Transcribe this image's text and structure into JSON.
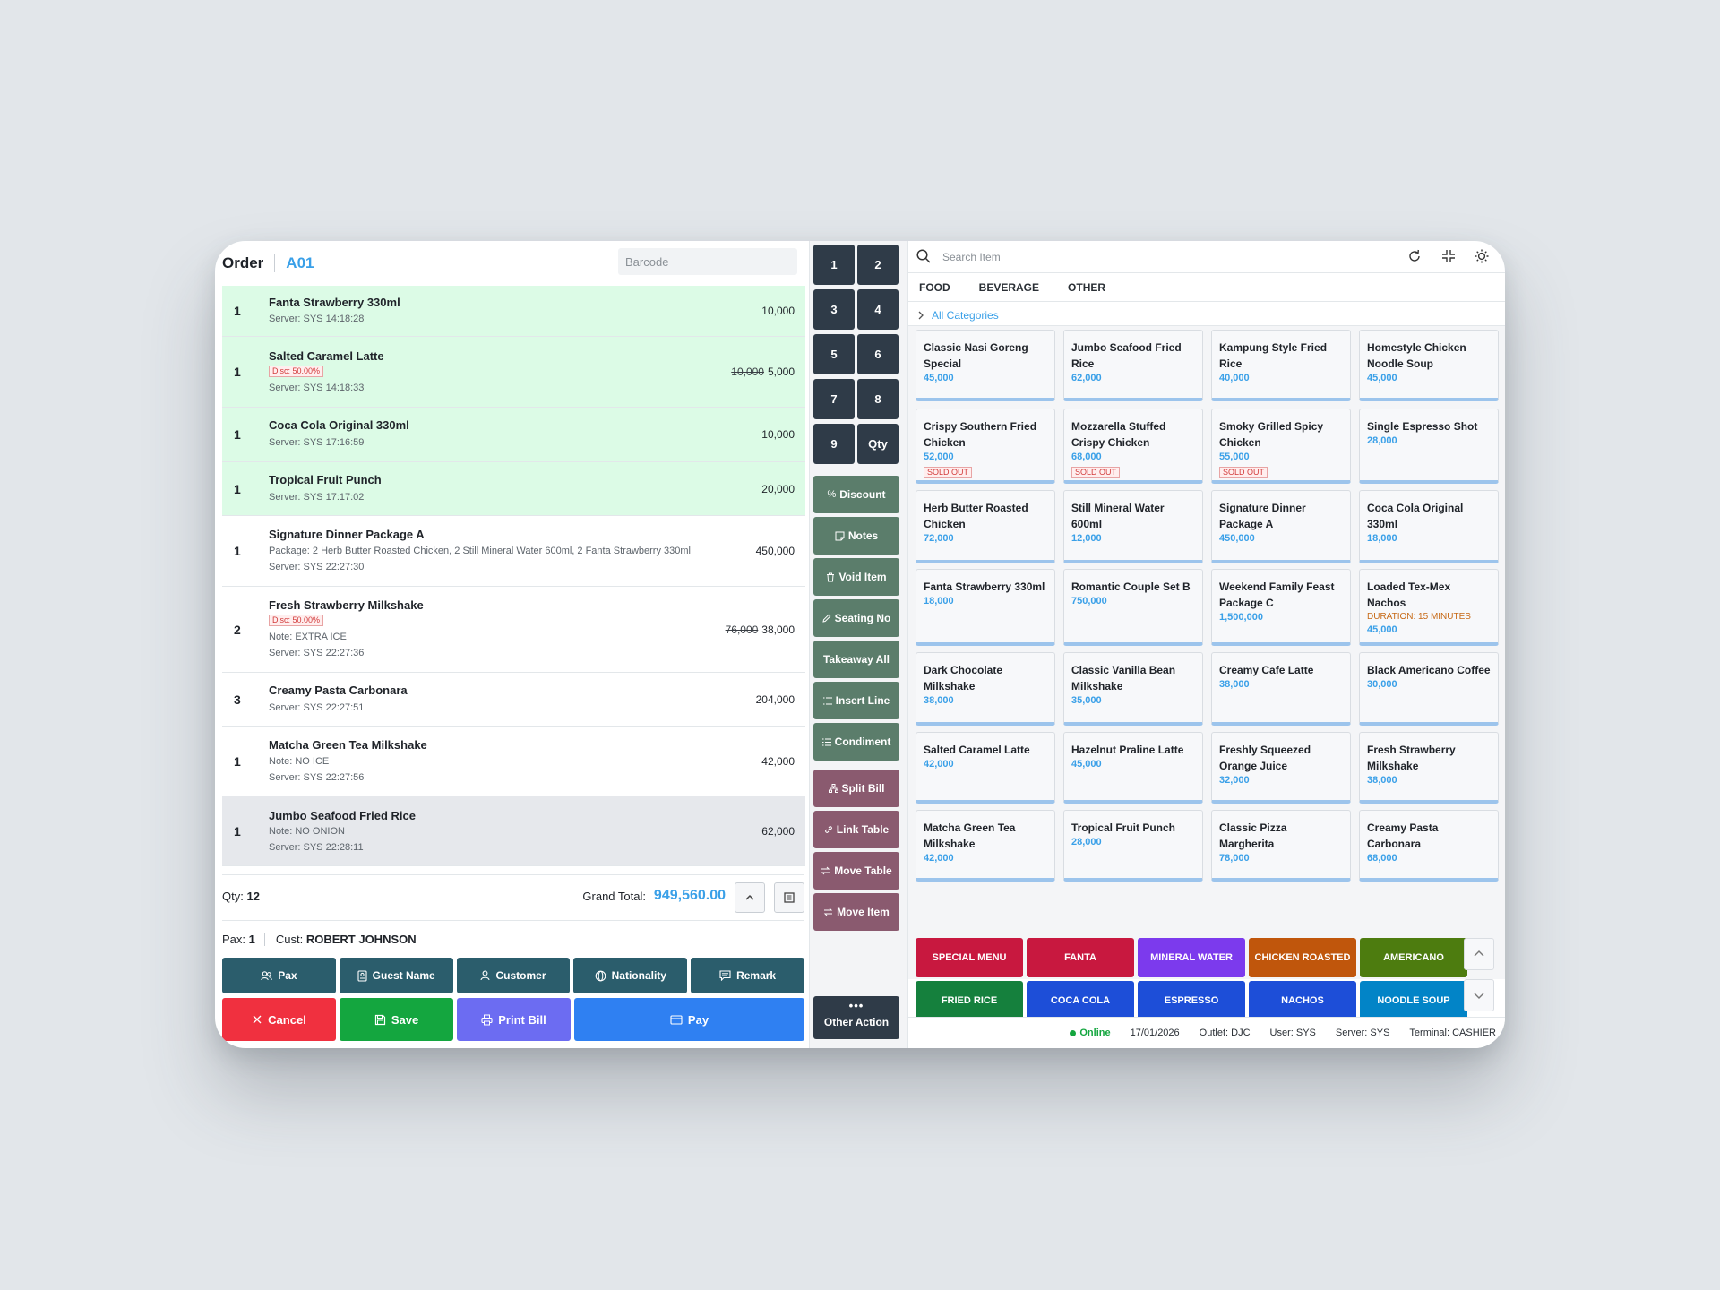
{
  "header": {
    "title": "Order",
    "table": "A01",
    "barcode_placeholder": "Barcode"
  },
  "order_lines": [
    {
      "qty": "1",
      "name": "Fanta Strawberry 330ml",
      "server": "Server: SYS 14:18:28",
      "price": "10,000",
      "status": "sent"
    },
    {
      "qty": "1",
      "name": "Salted Caramel Latte",
      "disc": "Disc: 50.00%",
      "server": "Server: SYS 14:18:33",
      "old_price": "10,000",
      "price": "5,000",
      "status": "sent"
    },
    {
      "qty": "1",
      "name": "Coca Cola Original 330ml",
      "server": "Server: SYS 17:16:59",
      "price": "10,000",
      "status": "sent"
    },
    {
      "qty": "1",
      "name": "Tropical Fruit Punch",
      "server": "Server: SYS 17:17:02",
      "price": "20,000",
      "status": "sent"
    },
    {
      "qty": "1",
      "name": "Signature Dinner Package A",
      "package": "Package: 2 Herb Butter Roasted Chicken, 2 Still Mineral Water 600ml, 2 Fanta Strawberry 330ml",
      "server": "Server: SYS 22:27:30",
      "price": "450,000",
      "status": "new"
    },
    {
      "qty": "2",
      "name": "Fresh Strawberry Milkshake",
      "disc": "Disc: 50.00%",
      "note": "Note: EXTRA ICE",
      "server": "Server: SYS 22:27:36",
      "old_price": "76,000",
      "price": "38,000",
      "status": "new"
    },
    {
      "qty": "3",
      "name": "Creamy Pasta Carbonara",
      "server": "Server: SYS 22:27:51",
      "price": "204,000",
      "status": "new"
    },
    {
      "qty": "1",
      "name": "Matcha Green Tea Milkshake",
      "note": "Note: NO ICE",
      "server": "Server: SYS 22:27:56",
      "price": "42,000",
      "status": "new"
    },
    {
      "qty": "1",
      "name": "Jumbo Seafood Fried Rice",
      "note": "Note: NO ONION",
      "server": "Server: SYS 22:28:11",
      "price": "62,000",
      "status": "selected"
    }
  ],
  "summary": {
    "qty_label": "Qty:",
    "qty": "12",
    "grand_total_label": "Grand Total:",
    "grand_total": "949,560.00"
  },
  "customer": {
    "pax_label": "Pax:",
    "pax": "1",
    "cust_label": "Cust:",
    "cust": "ROBERT JOHNSON"
  },
  "info_buttons": {
    "pax": "Pax",
    "guest_name": "Guest Name",
    "customer": "Customer",
    "nationality": "Nationality",
    "remark": "Remark"
  },
  "action_buttons": {
    "cancel": "Cancel",
    "save": "Save",
    "print_bill": "Print Bill",
    "pay": "Pay"
  },
  "numpad": [
    "1",
    "2",
    "3",
    "4",
    "5",
    "6",
    "7",
    "8",
    "9",
    "Qty"
  ],
  "side_actions": {
    "discount": "Discount",
    "notes": "Notes",
    "void_item": "Void Item",
    "seating_no": "Seating No",
    "takeaway_all": "Takeaway All",
    "insert_line": "Insert Line",
    "condiment": "Condiment",
    "split_bill": "Split Bill",
    "link_table": "Link Table",
    "move_table": "Move Table",
    "move_item": "Move Item",
    "other_action": "Other Action"
  },
  "search": {
    "placeholder": "Search Item"
  },
  "tabs": [
    "FOOD",
    "BEVERAGE",
    "OTHER"
  ],
  "breadcrumb": "All Categories",
  "menu_items": [
    {
      "name": "Classic Nasi Goreng Special",
      "price": "45,000"
    },
    {
      "name": "Jumbo Seafood Fried Rice",
      "price": "62,000"
    },
    {
      "name": "Kampung Style Fried Rice",
      "price": "40,000"
    },
    {
      "name": "Homestyle Chicken Noodle Soup",
      "price": "45,000"
    },
    {
      "name": "Crispy Southern Fried Chicken",
      "price": "52,000",
      "badge": "SOLD OUT"
    },
    {
      "name": "Mozzarella Stuffed Crispy Chicken",
      "price": "68,000",
      "badge": "SOLD OUT"
    },
    {
      "name": "Smoky Grilled Spicy Chicken",
      "price": "55,000",
      "badge": "SOLD OUT"
    },
    {
      "name": "Single Espresso Shot",
      "price": "28,000"
    },
    {
      "name": "Herb Butter Roasted Chicken",
      "price": "72,000"
    },
    {
      "name": "Still Mineral Water 600ml",
      "price": "12,000"
    },
    {
      "name": "Signature Dinner Package A",
      "price": "450,000"
    },
    {
      "name": "Coca Cola Original 330ml",
      "price": "18,000"
    },
    {
      "name": "Fanta Strawberry 330ml",
      "price": "18,000"
    },
    {
      "name": "Romantic Couple Set B",
      "price": "750,000"
    },
    {
      "name": "Weekend Family Feast Package C",
      "price": "1,500,000"
    },
    {
      "name": "Loaded Tex-Mex Nachos",
      "duration": "DURATION: 15 MINUTES",
      "price": "45,000"
    },
    {
      "name": "Dark Chocolate Milkshake",
      "price": "38,000"
    },
    {
      "name": "Classic Vanilla Bean Milkshake",
      "price": "35,000"
    },
    {
      "name": "Creamy Cafe Latte",
      "price": "38,000"
    },
    {
      "name": "Black Americano Coffee",
      "price": "30,000"
    },
    {
      "name": "Salted Caramel Latte",
      "price": "42,000"
    },
    {
      "name": "Hazelnut Praline Latte",
      "price": "45,000"
    },
    {
      "name": "Freshly Squeezed Orange Juice",
      "price": "32,000"
    },
    {
      "name": "Fresh Strawberry Milkshake",
      "price": "38,000"
    },
    {
      "name": "Matcha Green Tea Milkshake",
      "price": "42,000"
    },
    {
      "name": "Tropical Fruit Punch",
      "price": "28,000"
    },
    {
      "name": "Classic Pizza Margherita",
      "price": "78,000"
    },
    {
      "name": "Creamy Pasta Carbonara",
      "price": "68,000"
    }
  ],
  "quick_buttons": [
    {
      "label": "SPECIAL MENU",
      "color": "#c8183f"
    },
    {
      "label": "FANTA",
      "color": "#c8183f"
    },
    {
      "label": "MINERAL WATER",
      "color": "#7c3aed"
    },
    {
      "label": "CHICKEN ROASTED",
      "color": "#c0560c"
    },
    {
      "label": "AMERICANO",
      "color": "#4d7c0f"
    },
    {
      "label": "FRIED RICE",
      "color": "#15803d"
    },
    {
      "label": "COCA COLA",
      "color": "#1d4ed8"
    },
    {
      "label": "ESPRESSO",
      "color": "#1d4ed8"
    },
    {
      "label": "NACHOS",
      "color": "#1d4ed8"
    },
    {
      "label": "NOODLE SOUP",
      "color": "#0284c7"
    }
  ],
  "status_bar": {
    "online": "Online",
    "date": "17/01/2026",
    "outlet": "Outlet: DJC",
    "user": "User: SYS",
    "server": "Server: SYS",
    "terminal": "Terminal: CASHIER"
  },
  "colors": {
    "accent": "#3aa0e8",
    "sent_row": "#dcfbe6",
    "numpad": "#2f3b48",
    "action_green": "#5b7d6b",
    "action_mauve": "#8a5a6f",
    "info_button": "#2b5d6c"
  }
}
